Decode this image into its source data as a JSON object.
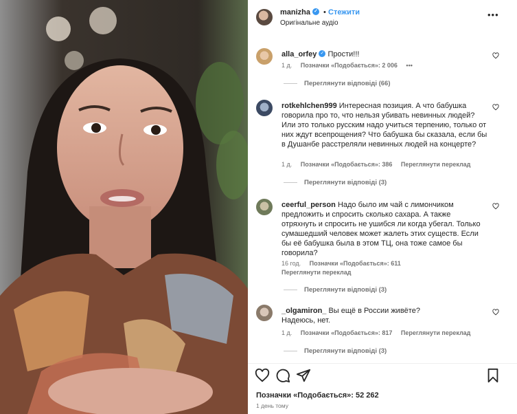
{
  "post": {
    "username": "manizha",
    "follow_label": "Стежити",
    "audio_label": "Оригінальне аудіо",
    "more_label": "•••"
  },
  "comments": [
    {
      "username": "alla_orfey",
      "text": "Прости!!!",
      "time": "1 д.",
      "likes": "Позначки «Подобається»: 2 006",
      "extra": "•••",
      "replies": "Переглянути відповіді (66)",
      "verified": true
    },
    {
      "username": "rotkehlchen999",
      "text": "Интересная позиция. А что бабушка говорила про то, что нельзя убивать невинных людей? Или это только русским надо учиться терпению, только от них ждут всепрощения? Что бабушка бы сказала, если бы в Душанбе расстреляли невинных людей на концерте?",
      "time": "1 д.",
      "likes": "Позначки «Подобається»: 386",
      "extra": "Переглянути переклад",
      "replies": "Переглянути відповіді (3)"
    },
    {
      "username": "ceerful_person",
      "text": "Надо было им чай с лимончиком предложить и спросить сколько сахара. А также отряхнуть и спросить не ушибся ли когда убегал. Только сумашедший человек может жалеть этих существ. Если бы её бабушка была в этом ТЦ, она тоже самое бы говорила?",
      "time": "16 год.",
      "likes": "Позначки «Подобається»: 611",
      "extra": "Переглянути переклад",
      "replies": "Переглянути відповіді (3)"
    },
    {
      "username": "_olgamiron_",
      "text": "Вы ещё в России живёте?",
      "text2": "Надеюсь, нет.",
      "time": "1 д.",
      "likes": "Позначки «Подобається»: 817",
      "extra": "Переглянути переклад",
      "replies": "Переглянути відповіді (3)"
    }
  ],
  "footer": {
    "likes": "Позначки «Подобається»: 52 262",
    "time": "1 день тому"
  },
  "colors": {
    "accent": "#3897f0",
    "muted": "#737373",
    "text": "#262626"
  },
  "icons": [
    "heart-icon",
    "comment-icon",
    "share-icon",
    "bookmark-icon",
    "more-icon",
    "verified-icon"
  ]
}
